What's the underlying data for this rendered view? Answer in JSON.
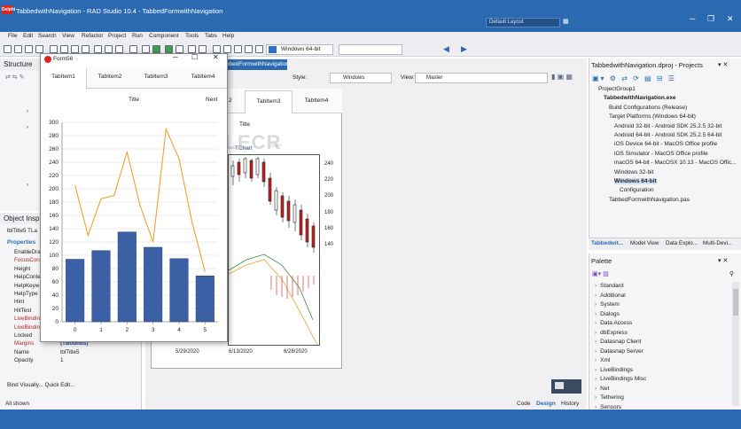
{
  "window": {
    "app_badge": "Delphi",
    "title": "TabbedwithNavigation - RAD Studio 10.4 - TabbedFormwithNavigation",
    "layout_dropdown": "Default Layout",
    "minimize": "─",
    "restore": "❐",
    "close": "✕"
  },
  "menu": [
    "File",
    "Edit",
    "Search",
    "View",
    "Refactor",
    "Project",
    "Run",
    "Component",
    "Tools",
    "Tabs",
    "Help"
  ],
  "toolbar": {
    "platform": "Windows 64-bit",
    "config": ""
  },
  "structure": {
    "title": "Structure",
    "pin": "▾ ✕"
  },
  "object_inspector": {
    "title": "Object Insp",
    "selector": "lblTitle5  TLa",
    "tabs": [
      "Properties"
    ],
    "rows": [
      {
        "name": "EnableDra",
        "value": ""
      },
      {
        "name": "FocusCon",
        "value": ""
      },
      {
        "name": "Height",
        "value": ""
      },
      {
        "name": "HelpConte",
        "value": ""
      },
      {
        "name": "HelpKeyw",
        "value": ""
      },
      {
        "name": "HelpType",
        "value": ""
      },
      {
        "name": "Hint",
        "value": ""
      },
      {
        "name": "HitTest",
        "value": ""
      },
      {
        "name": "LiveBindin",
        "value": ""
      },
      {
        "name": "LiveBindin",
        "value": ""
      },
      {
        "name": "Locked",
        "value": "False"
      },
      {
        "name": "Margins",
        "value": "(TBounds)"
      },
      {
        "name": "Name",
        "value": "lblTitle5"
      },
      {
        "name": "Opacity",
        "value": "1"
      }
    ],
    "footer": "Bind Visually...  Quick Edit...",
    "status": "All shown"
  },
  "editor": {
    "tab": "TabbedFormwithNavigation",
    "style_label": "Style:",
    "style_value": "Windows",
    "view_label": "View:",
    "view_value": "Master",
    "designer_tabs": [
      "TabItem2",
      "TabItem3",
      "TabItem4"
    ],
    "designer_tab_prefix": "2",
    "designer_title": "Title",
    "chart_label": "TChart",
    "x_dates": [
      "5/29/2020",
      "6/13/2020",
      "6/28/2020"
    ],
    "y_ticks": [
      "240",
      "220",
      "200",
      "180",
      "160",
      "140"
    ],
    "bottom_tabs": [
      "Code",
      "Design",
      "History"
    ]
  },
  "watermark": {
    "main": "FILECR",
    "sub": ".com"
  },
  "form": {
    "title": "Form56",
    "minimize": "─",
    "restore": "☐",
    "close": "✕",
    "tabs": [
      "TabItem1",
      "TabItem2",
      "TabItem3",
      "TabItem4"
    ],
    "toolbar_title": "Title",
    "next_button": "Next"
  },
  "project": {
    "title": "TabbedwithNavigation.dproj - Projects",
    "items": [
      {
        "level": 0,
        "text": "ProjectGroup1",
        "bold": false
      },
      {
        "level": 1,
        "text": "TabbedwithNavigation.exe",
        "bold": true
      },
      {
        "level": 2,
        "text": "Build Configurations (Release)",
        "bold": false
      },
      {
        "level": 2,
        "text": "Target Platforms (Windows 64-bit)",
        "bold": false
      },
      {
        "level": 3,
        "text": "Android 32-bit - Android SDK 25.2.5 32-bit",
        "bold": false
      },
      {
        "level": 3,
        "text": "Android 64-bit - Android SDK 25.2.5 64-bit",
        "bold": false
      },
      {
        "level": 3,
        "text": "iOS Device 64-bit - MacOS Office profile",
        "bold": false
      },
      {
        "level": 3,
        "text": "iOS Simulator - MacOS Office profile",
        "bold": false
      },
      {
        "level": 3,
        "text": "macOS 64-bit - MacOSX 10.13 - MacOS Offic...",
        "bold": false
      },
      {
        "level": 3,
        "text": "Windows 32-bit",
        "bold": false
      },
      {
        "level": 3,
        "text": "Windows 64-bit",
        "bold": true
      },
      {
        "level": 4,
        "text": "Configuration",
        "bold": false
      },
      {
        "level": 2,
        "text": "TabbedFormwithNavigation.pas",
        "bold": false
      }
    ],
    "bottom_tabs": [
      "Tabbedwit...",
      "Model View",
      "Data Explo...",
      "Multi-Devi..."
    ]
  },
  "palette": {
    "title": "Palette",
    "items": [
      "Standard",
      "Additional",
      "System",
      "Dialogs",
      "Data Access",
      "dbExpress",
      "Datasnap Client",
      "Datasnap Server",
      "Xml",
      "LiveBindings",
      "LiveBindings Misc",
      "Net",
      "Tethering",
      "Sensors"
    ]
  },
  "chart_data": {
    "type": "bar",
    "categories": [
      "0",
      "1",
      "2",
      "3",
      "4",
      "5"
    ],
    "values": [
      94,
      107,
      135,
      112,
      95,
      69
    ],
    "ylim": [
      0,
      300
    ],
    "yticks": [
      0,
      20,
      40,
      60,
      80,
      100,
      120,
      140,
      160,
      180,
      200,
      220,
      240,
      260,
      280,
      300
    ],
    "line_series": {
      "x": [
        0,
        0.5,
        1,
        1.5,
        2,
        2.5,
        3,
        3.5,
        4,
        4.5,
        5
      ],
      "values": [
        205,
        130,
        185,
        190,
        255,
        175,
        120,
        290,
        245,
        150,
        75
      ]
    },
    "colors": {
      "bar": "#3b60a6",
      "line": "#f0a030"
    }
  }
}
